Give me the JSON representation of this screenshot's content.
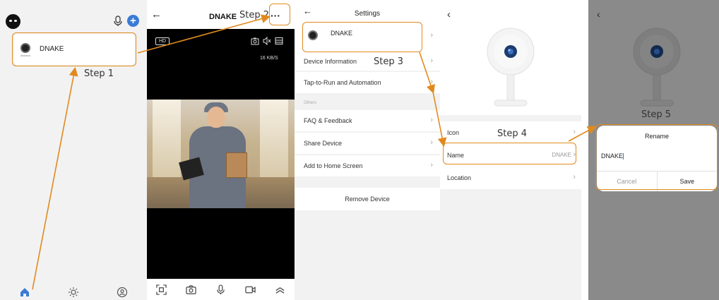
{
  "steps": {
    "step1": "Step 1",
    "step2": "Step 2",
    "step3": "Step 3",
    "step4": "Step 4",
    "step5": "Step 5"
  },
  "annotation_color": "#e08a1e",
  "home": {
    "device_name": "DNAKE",
    "icons": [
      "avatar-icon",
      "microphone-icon",
      "add-icon"
    ],
    "tabs": [
      "home-icon",
      "scene-icon",
      "profile-icon"
    ]
  },
  "live_view": {
    "title": "DNAKE",
    "quality_label": "HD",
    "speed": "16 KB/S",
    "top_icons": [
      "snapshot-icon",
      "mute-icon",
      "layout-icon"
    ],
    "controls": [
      "screenshot-icon",
      "camera-icon",
      "microphone-icon",
      "record-icon",
      "expand-icon"
    ]
  },
  "settings": {
    "title": "Settings",
    "device_name": "DNAKE",
    "items": [
      {
        "label": "Device Information"
      },
      {
        "label": "Tap-to-Run and Automation"
      }
    ],
    "section_label": "Others",
    "other_items": [
      {
        "label": "FAQ & Feedback"
      },
      {
        "label": "Share Device"
      },
      {
        "label": "Add to Home Screen"
      }
    ],
    "remove_label": "Remove Device"
  },
  "detail": {
    "rows": [
      {
        "label": "Icon",
        "value": ""
      },
      {
        "label": "Name",
        "value": "DNAKE"
      },
      {
        "label": "Location",
        "value": ""
      }
    ]
  },
  "rename": {
    "title": "Rename",
    "value": "DNAKE",
    "cancel": "Cancel",
    "save": "Save"
  },
  "accent_color": "#3a7bd5"
}
